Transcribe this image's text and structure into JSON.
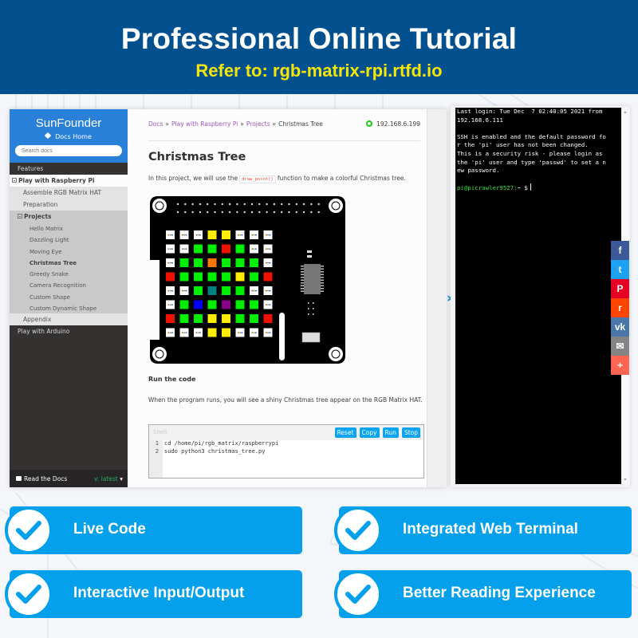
{
  "banner": {
    "title": "Professional Online Tutorial",
    "subtitle": "Refer to: rgb-matrix-rpi.rtfd.io"
  },
  "sidebar": {
    "logo": "SunFounder",
    "home_label": "Docs Home",
    "search_placeholder": "Search docs",
    "items": [
      {
        "label": "Features",
        "level": 1,
        "current": false
      },
      {
        "label": "Play with Raspberry Pi",
        "level": 1,
        "current": true,
        "expanded": true
      },
      {
        "label": "Assemble RGB Matrix HAT",
        "level": 2,
        "current": false
      },
      {
        "label": "Preparation",
        "level": 2,
        "current": false
      },
      {
        "label": "Projects",
        "level": 2,
        "current": true,
        "expanded": true
      },
      {
        "label": "Hello Matrix",
        "level": 3,
        "current": false
      },
      {
        "label": "Dazzling Light",
        "level": 3,
        "current": false
      },
      {
        "label": "Moving Eye",
        "level": 3,
        "current": false
      },
      {
        "label": "Christmas Tree",
        "level": 3,
        "current": true
      },
      {
        "label": "Greedy Snake",
        "level": 3,
        "current": false
      },
      {
        "label": "Camera Recognition",
        "level": 3,
        "current": false
      },
      {
        "label": "Custom Shape",
        "level": 3,
        "current": false
      },
      {
        "label": "Custom Dynamic Shape",
        "level": 3,
        "current": false
      },
      {
        "label": "Appendix",
        "level": 2,
        "current": false
      },
      {
        "label": "Play with Arduino",
        "level": 1,
        "current": false
      }
    ],
    "footer_label": "Read the Docs",
    "version": "v: latest"
  },
  "content": {
    "breadcrumb": [
      {
        "label": "Docs",
        "link": true
      },
      {
        "label": "Play with Raspberry Pi",
        "link": true
      },
      {
        "label": "Projects",
        "link": true
      },
      {
        "label": "Christmas Tree",
        "link": false
      }
    ],
    "breadcrumb_sep": "»",
    "ip_address": "192.168.6.199",
    "title": "Christmas Tree",
    "intro_before": "In this project, we will use the",
    "intro_code": "draw_point()",
    "intro_after": "function to make a colorful Christmas tree.",
    "matrix": [
      [
        "W",
        "W",
        "W",
        "Y",
        "Y",
        "W",
        "W",
        "W"
      ],
      [
        "W",
        "W",
        "G",
        "G",
        "R",
        "G",
        "W",
        "W"
      ],
      [
        "W",
        "G",
        "G",
        "O",
        "G",
        "G",
        "G",
        "W"
      ],
      [
        "R",
        "G",
        "G",
        "G",
        "G",
        "Y",
        "G",
        "R"
      ],
      [
        "W",
        "W",
        "G",
        "T",
        "G",
        "G",
        "W",
        "W"
      ],
      [
        "W",
        "G",
        "B",
        "G",
        "P",
        "G",
        "G",
        "W"
      ],
      [
        "R",
        "G",
        "G",
        "Y",
        "Y",
        "G",
        "G",
        "R"
      ],
      [
        "W",
        "W",
        "W",
        "Y",
        "Y",
        "W",
        "W",
        "W"
      ]
    ],
    "matrix_colors": {
      "W": "#ffffff",
      "Y": "#ffee00",
      "G": "#00ee00",
      "R": "#ee1100",
      "O": "#ff7700",
      "T": "#008080",
      "B": "#0000ff",
      "P": "#880088"
    },
    "run_heading": "Run the code",
    "run_text": "When the program runs, you will see a shiny Christmas tree appear on the RGB Matrix HAT.",
    "shell": {
      "label": "Shell",
      "buttons": [
        "Reset",
        "Copy",
        "Run",
        "Stop"
      ],
      "lines": [
        {
          "num": "1",
          "text": "cd /home/pi/rgb_matrix/raspberrypi"
        },
        {
          "num": "2",
          "text": "sudo python3 christmas_tree.py"
        }
      ]
    }
  },
  "terminal": {
    "lines": [
      "Last login: Tue Dec  7 02:40:05 2021 from",
      "192.168.6.111",
      "",
      "SSH is enabled and the default password fo",
      "r the 'pi' user has not been changed.",
      "This is a security risk - please login as",
      "the 'pi' user and type 'passwd' to set a n",
      "ew password.",
      ""
    ],
    "prompt": "pi@picrawler9527:",
    "prompt_suffix": "~ $"
  },
  "share": [
    {
      "name": "facebook",
      "glyph": "f",
      "color": "#3b5998"
    },
    {
      "name": "twitter",
      "glyph": "t",
      "color": "#1da1f2"
    },
    {
      "name": "pinterest",
      "glyph": "P",
      "color": "#e60023"
    },
    {
      "name": "reddit",
      "glyph": "r",
      "color": "#ff4500"
    },
    {
      "name": "vk",
      "glyph": "vk",
      "color": "#4a76a8"
    },
    {
      "name": "email",
      "glyph": "✉",
      "color": "#848484"
    },
    {
      "name": "more",
      "glyph": "+",
      "color": "#ff6550"
    }
  ],
  "features": [
    {
      "label": "Live Code"
    },
    {
      "label": "Integrated Web Terminal"
    },
    {
      "label": "Interactive Input/Output"
    },
    {
      "label": "Better Reading Experience"
    }
  ],
  "accent_color": "#05a0eb"
}
